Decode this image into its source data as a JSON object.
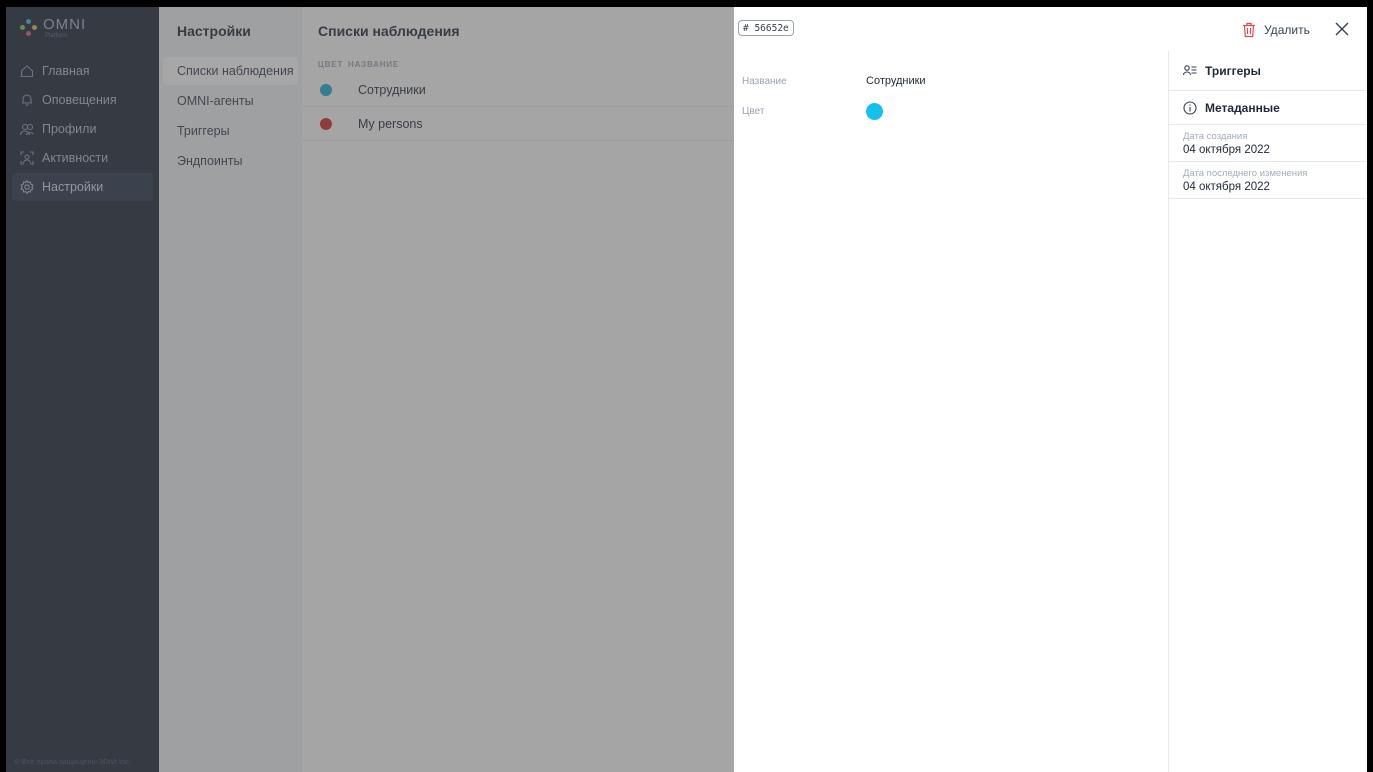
{
  "app": {
    "logo_text": "OMNI",
    "logo_subtext": "Platform",
    "footer": "© Все права защищены 3DiVi Inc."
  },
  "nav": {
    "items": [
      {
        "label": "Главная",
        "icon": "home-icon"
      },
      {
        "label": "Оповещения",
        "icon": "bell-icon"
      },
      {
        "label": "Профили",
        "icon": "profiles-icon"
      },
      {
        "label": "Активности",
        "icon": "activity-icon"
      },
      {
        "label": "Настройки",
        "icon": "gear-icon",
        "active": true
      }
    ]
  },
  "settings_menu": {
    "title": "Настройки",
    "items": [
      {
        "label": "Списки наблюдения",
        "active": true
      },
      {
        "label": "OMNI-агенты"
      },
      {
        "label": "Триггеры"
      },
      {
        "label": "Эндпоинты"
      }
    ]
  },
  "main": {
    "title": "Списки наблюдения",
    "columns": [
      "ЦВЕТ",
      "НАЗВАНИЕ"
    ],
    "rows": [
      {
        "name": "Сотрудники",
        "color": "#1aa8d8"
      },
      {
        "name": "My persons",
        "color": "#cc2a2a"
      }
    ]
  },
  "panel": {
    "id_badge": "# 56652e",
    "delete_label": "Удалить",
    "fields": [
      {
        "label": "Название",
        "value": "Сотрудники"
      },
      {
        "label": "Цвет",
        "color": "#14c0ee"
      }
    ],
    "side": {
      "triggers_title": "Триггеры",
      "metadata_title": "Метаданные",
      "meta": [
        {
          "label": "Дата создания",
          "value": "04 октября 2022"
        },
        {
          "label": "Дата последнего изменения",
          "value": "04 октября 2022"
        }
      ]
    }
  },
  "colors": {
    "nav_bg": "#1b2536",
    "accent_delete": "#e04a4a",
    "logo_dots": [
      "#3bb7e6",
      "#7bc86c",
      "#f1b740",
      "#e0567a"
    ]
  }
}
